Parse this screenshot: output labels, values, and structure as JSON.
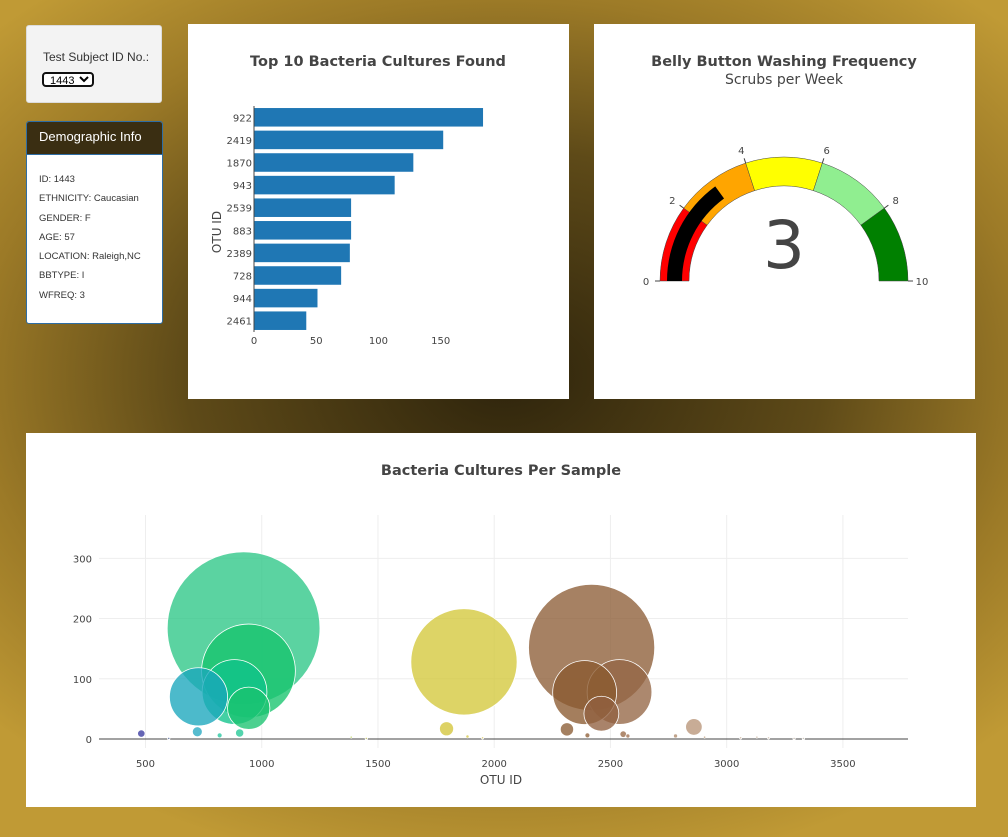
{
  "selector": {
    "label": "Test Subject ID No.:",
    "selected": "1443"
  },
  "demographics": {
    "title": "Demographic Info",
    "lines": [
      "ID: 1443",
      "ETHNICITY: Caucasian",
      "GENDER: F",
      "AGE: 57",
      "LOCATION: Raleigh,NC",
      "BBTYPE: I",
      "WFREQ: 3"
    ]
  },
  "chart_data": [
    {
      "type": "bar",
      "orientation": "horizontal",
      "title": "Top 10 Bacteria Cultures Found",
      "ylabel": "OTU ID",
      "xlabel": "",
      "categories": [
        "922",
        "2419",
        "1870",
        "943",
        "2539",
        "883",
        "2389",
        "728",
        "944",
        "2461"
      ],
      "values": [
        184,
        152,
        128,
        113,
        78,
        78,
        77,
        70,
        51,
        42
      ],
      "xlim": [
        0,
        192
      ],
      "xticks": [
        0,
        50,
        100,
        150
      ],
      "color": "#1f77b4"
    },
    {
      "type": "gauge",
      "title": "Belly Button Washing Frequency",
      "subtitle": "Scrubs per Week",
      "value": 3,
      "range": [
        0,
        10
      ],
      "ticks": [
        0,
        2,
        4,
        6,
        8,
        10
      ],
      "steps": [
        {
          "range": [
            0,
            2
          ],
          "color": "#ff0000"
        },
        {
          "range": [
            2,
            4
          ],
          "color": "#ffa500"
        },
        {
          "range": [
            4,
            6
          ],
          "color": "#ffff00"
        },
        {
          "range": [
            6,
            8
          ],
          "color": "#90ee90"
        },
        {
          "range": [
            8,
            10
          ],
          "color": "#008000"
        }
      ],
      "bar_color": "#000000"
    },
    {
      "type": "scatter",
      "subtype": "bubble",
      "title": "Bacteria Cultures Per Sample",
      "xlabel": "OTU ID",
      "ylabel": "",
      "xlim": [
        300,
        3780
      ],
      "ylim": [
        -15,
        372
      ],
      "xticks": [
        500,
        1000,
        1500,
        2000,
        2500,
        3000,
        3500
      ],
      "yticks": [
        0,
        100,
        200,
        300
      ],
      "grid": true,
      "points": [
        {
          "x": 482,
          "y": 9,
          "color": "#3a3aa0"
        },
        {
          "x": 600,
          "y": 1,
          "color": "#6a7fb0"
        },
        {
          "x": 723,
          "y": 12,
          "color": "#27a9c2"
        },
        {
          "x": 728,
          "y": 70,
          "color": "#1aa7bd"
        },
        {
          "x": 819,
          "y": 6,
          "color": "#26c6a0"
        },
        {
          "x": 883,
          "y": 78,
          "color": "#10c38a"
        },
        {
          "x": 905,
          "y": 10,
          "color": "#22c896"
        },
        {
          "x": 922,
          "y": 184,
          "color": "#2dc787"
        },
        {
          "x": 943,
          "y": 113,
          "color": "#16c46d"
        },
        {
          "x": 944,
          "y": 51,
          "color": "#19c36f"
        },
        {
          "x": 1385,
          "y": 3,
          "color": "#c2d86a"
        },
        {
          "x": 1450,
          "y": 1,
          "color": "#d0d06a"
        },
        {
          "x": 1795,
          "y": 17,
          "color": "#d4c53a"
        },
        {
          "x": 1870,
          "y": 128,
          "color": "#d4c83b"
        },
        {
          "x": 1885,
          "y": 4,
          "color": "#d6c84a"
        },
        {
          "x": 1950,
          "y": 2,
          "color": "#d8c860"
        },
        {
          "x": 2313,
          "y": 16,
          "color": "#8a5c34"
        },
        {
          "x": 2389,
          "y": 77,
          "color": "#8a5a30"
        },
        {
          "x": 2401,
          "y": 6,
          "color": "#8f6038"
        },
        {
          "x": 2419,
          "y": 152,
          "color": "#8d5e37"
        },
        {
          "x": 2461,
          "y": 42,
          "color": "#916040"
        },
        {
          "x": 2539,
          "y": 78,
          "color": "#956745"
        },
        {
          "x": 2555,
          "y": 8,
          "color": "#9a6a48"
        },
        {
          "x": 2575,
          "y": 5,
          "color": "#a07050"
        },
        {
          "x": 2780,
          "y": 5,
          "color": "#b08a6a"
        },
        {
          "x": 2859,
          "y": 20,
          "color": "#b99579"
        },
        {
          "x": 2905,
          "y": 3,
          "color": "#c0a080"
        },
        {
          "x": 3060,
          "y": 2,
          "color": "#c8b09a"
        },
        {
          "x": 3130,
          "y": 3,
          "color": "#cbb8a5"
        },
        {
          "x": 3180,
          "y": 2,
          "color": "#cfbfb0"
        },
        {
          "x": 3290,
          "y": 1,
          "color": "#d3c8bb"
        },
        {
          "x": 3330,
          "y": 1,
          "color": "#d6cdc2"
        }
      ]
    }
  ]
}
